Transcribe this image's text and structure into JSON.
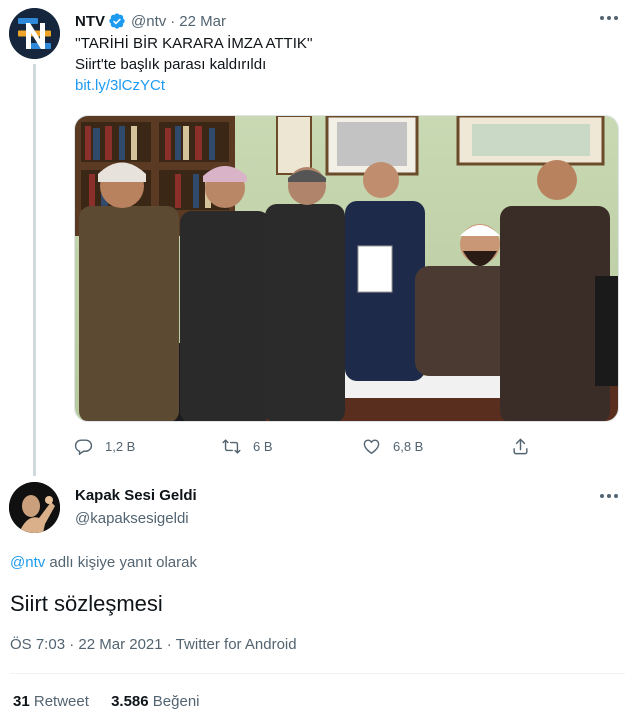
{
  "tweet": {
    "author_name": "NTV",
    "author_handle": "@ntv",
    "date": "22 Mar",
    "line1": "''TARİHİ BİR KARARA İMZA ATTIK''",
    "line2": "Siirt'te başlık parası kaldırıldı",
    "link": "bit.ly/3lCzYCt",
    "replies": "1,2 B",
    "retweets": "6 B",
    "likes": "6,8 B"
  },
  "reply": {
    "author_name": "Kapak Sesi Geldi",
    "author_handle": "@kapaksesigeldi",
    "reply_to_handle": "@ntv",
    "reply_to_text": " adlı kişiye yanıt olarak",
    "text": "Siirt sözleşmesi",
    "time": "ÖS 7:03",
    "date": "22 Mar 2021",
    "source": "Twitter for Android",
    "retweet_count": "31",
    "retweet_label": "Retweet",
    "like_count": "3.586",
    "like_label": "Beğeni"
  },
  "colors": {
    "link": "#1d9bf0",
    "muted": "#536471",
    "text": "#0f1419",
    "verified": "#1d9bf0",
    "ntv_avatar_bg": "#15263d"
  },
  "icons": [
    "verified-badge-icon",
    "more-icon",
    "reply-icon",
    "retweet-icon",
    "like-icon",
    "share-icon"
  ]
}
